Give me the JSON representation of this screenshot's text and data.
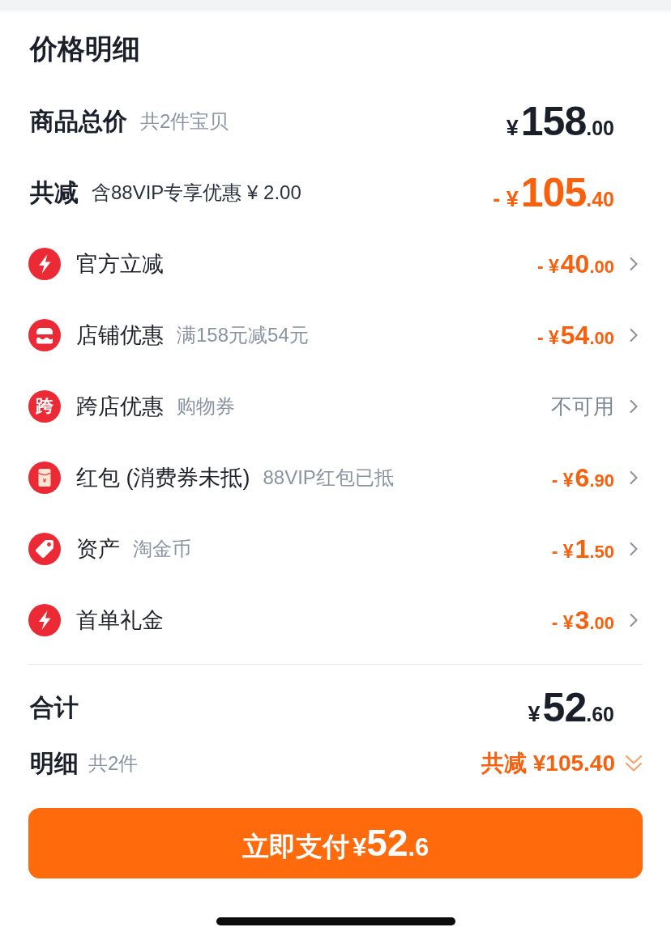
{
  "header": {
    "title": "价格明细"
  },
  "summary": [
    {
      "kind": "total",
      "label": "商品总价",
      "note": "共2件宝贝",
      "amount": {
        "prefix": "¥",
        "whole": "158",
        "fraction": ".00"
      }
    },
    {
      "kind": "discount",
      "label": "共减",
      "note": "含88VIP专享优惠 ¥ 2.00",
      "amount": {
        "prefix": "- ¥",
        "whole": "105",
        "fraction": ".40"
      }
    }
  ],
  "items": [
    {
      "icon": {
        "kind": "bolt"
      },
      "label": "官方立减",
      "value": {
        "kind": "amount",
        "prefix": "- ¥",
        "whole": "40",
        "fraction": ".00"
      }
    },
    {
      "icon": {
        "kind": "store"
      },
      "label": "店铺优惠",
      "note": "满158元减54元",
      "value": {
        "kind": "amount",
        "prefix": "- ¥",
        "whole": "54",
        "fraction": ".00"
      }
    },
    {
      "icon": {
        "kind": "glyph",
        "text": "跨"
      },
      "label": "跨店优惠",
      "note": "购物券",
      "value": {
        "kind": "status",
        "text": "不可用"
      }
    },
    {
      "icon": {
        "kind": "envelope",
        "text": "¥"
      },
      "label": "红包 (消费券未抵)",
      "note": "88VIP红包已抵",
      "value": {
        "kind": "amount",
        "prefix": "- ¥",
        "whole": "6",
        "fraction": ".90"
      }
    },
    {
      "icon": {
        "kind": "tag"
      },
      "label": "资产",
      "note": "淘金币",
      "value": {
        "kind": "amount",
        "prefix": "- ¥",
        "whole": "1",
        "fraction": ".50"
      }
    },
    {
      "icon": {
        "kind": "bolt"
      },
      "label": "首单礼金",
      "value": {
        "kind": "amount",
        "prefix": "- ¥",
        "whole": "3",
        "fraction": ".00"
      }
    }
  ],
  "total": {
    "label": "合计",
    "amount": {
      "prefix": "¥",
      "whole": "52",
      "fraction": ".60"
    }
  },
  "detail": {
    "label": "明细",
    "note": "共2件",
    "savings": "共减 ¥105.40"
  },
  "pay_button": {
    "label": "立即支付",
    "amount": {
      "prefix": "¥",
      "whole": "52",
      "fraction": ".6"
    }
  }
}
